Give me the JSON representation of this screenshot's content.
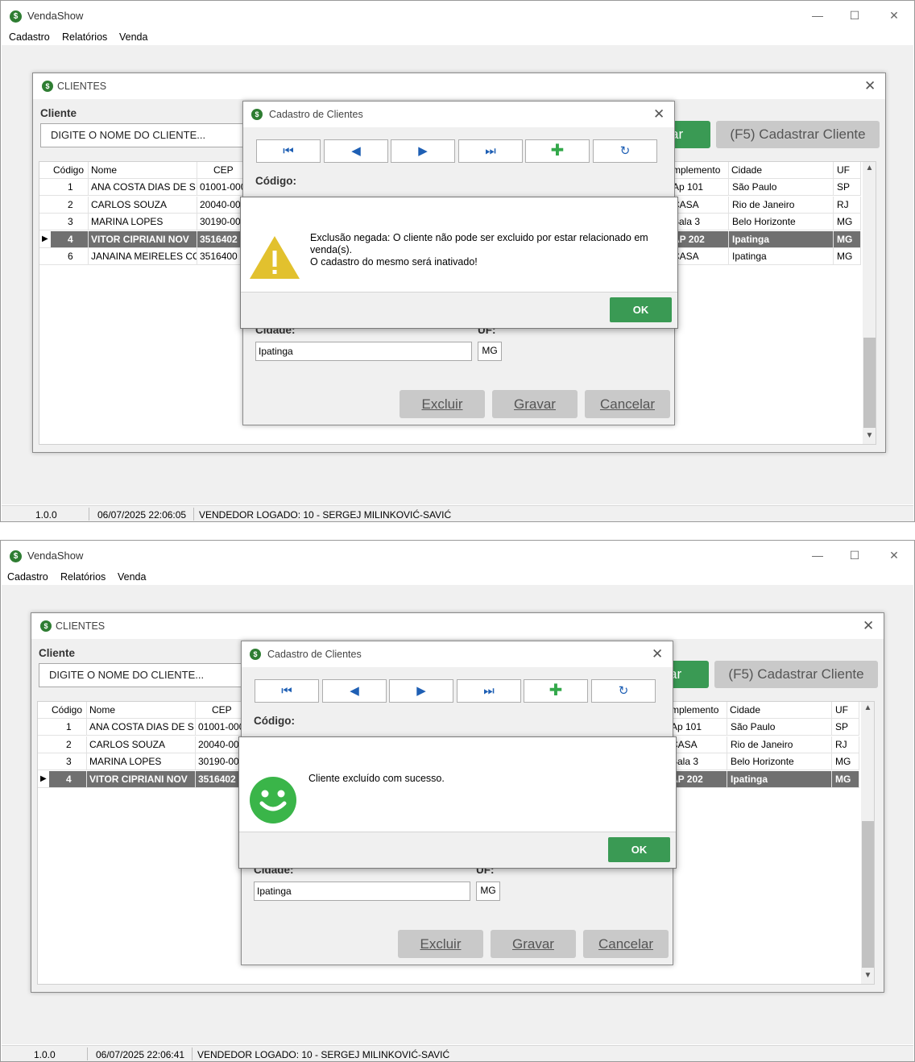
{
  "app": {
    "title": "VendaShow",
    "icon_letter": "$",
    "minimize": "—",
    "maximize": "☐",
    "close": "✕"
  },
  "menu": [
    "Cadastro",
    "Relatórios",
    "Venda"
  ],
  "clientes_window": {
    "title": "CLIENTES",
    "field_label": "Cliente",
    "search_value": "DIGITE O NOME DO CLIENTE...",
    "partial_button": "ar",
    "cadastrar_button": "(F5) Cadastrar Cliente",
    "columns": [
      "Código",
      "Nome",
      "CEP",
      "mplemento",
      "Cidade",
      "UF"
    ]
  },
  "cadastro_window": {
    "title": "Cadastro de Clientes",
    "nav": [
      "⏮",
      "◀",
      "▶",
      "⏭",
      "✚",
      "↻"
    ],
    "codigo_label": "Código:",
    "cidade_label": "Cidade:",
    "uf_label": "UF:",
    "cidade_value": "Ipatinga",
    "uf_value": "MG",
    "excluir": "Excluir",
    "gravar": "Gravar",
    "cancelar": "Cancelar"
  },
  "screens": [
    {
      "status": {
        "version": "1.0.0",
        "datetime": "06/07/2025 22:06:05",
        "vendedor": "VENDEDOR LOGADO:  10 - SERGEJ MILINKOVIĆ-SAVIĆ"
      },
      "rows": [
        {
          "codigo": "1",
          "nome": "ANA COSTA DIAS DE S",
          "cep": "01001-000",
          "complemento": "Ap 101",
          "cidade": "São Paulo",
          "uf": "SP",
          "selected": false
        },
        {
          "codigo": "2",
          "nome": "CARLOS SOUZA",
          "cep": "20040-00",
          "complemento": "CASA",
          "cidade": "Rio de Janeiro",
          "uf": "RJ",
          "selected": false
        },
        {
          "codigo": "3",
          "nome": " MARINA LOPES",
          "cep": "30190-00",
          "complemento": "Sala 3",
          "cidade": "Belo Horizonte",
          "uf": "MG",
          "selected": false
        },
        {
          "codigo": "4",
          "nome": "VITOR CIPRIANI NOV",
          "cep": "3516402",
          "complemento": "AP 202",
          "cidade": "Ipatinga",
          "uf": "MG",
          "selected": true
        },
        {
          "codigo": "6",
          "nome": "JANAINA MEIRELES CC",
          "cep": "3516400",
          "complemento": "CASA",
          "cidade": "Ipatinga",
          "uf": "MG",
          "selected": false
        }
      ],
      "message": {
        "kind": "warning",
        "lines": [
          "Exclusão negada: O cliente não pode ser excluido por estar relacionado em venda(s).",
          "O cadastro do mesmo será inativado!"
        ],
        "ok": "OK"
      }
    },
    {
      "status": {
        "version": "1.0.0",
        "datetime": "06/07/2025 22:06:41",
        "vendedor": "VENDEDOR LOGADO:  10 - SERGEJ MILINKOVIĆ-SAVIĆ"
      },
      "rows": [
        {
          "codigo": "1",
          "nome": "ANA COSTA DIAS DE S",
          "cep": "01001-000",
          "complemento": "Ap 101",
          "cidade": "São Paulo",
          "uf": "SP",
          "selected": false
        },
        {
          "codigo": "2",
          "nome": "CARLOS SOUZA",
          "cep": "20040-00",
          "complemento": "CASA",
          "cidade": "Rio de Janeiro",
          "uf": "RJ",
          "selected": false
        },
        {
          "codigo": "3",
          "nome": " MARINA LOPES",
          "cep": "30190-00",
          "complemento": "Sala 3",
          "cidade": "Belo Horizonte",
          "uf": "MG",
          "selected": false
        },
        {
          "codigo": "4",
          "nome": "VITOR CIPRIANI NOV",
          "cep": "3516402",
          "complemento": "AP 202",
          "cidade": "Ipatinga",
          "uf": "MG",
          "selected": true
        }
      ],
      "message": {
        "kind": "success",
        "lines": [
          "Cliente excluído com sucesso."
        ],
        "ok": "OK"
      }
    }
  ],
  "colors": {
    "accent_green": "#3a9a54",
    "selected_row": "#707070",
    "nav_blue": "#1e5fb4",
    "warning_yellow": "#e2c12e",
    "success_green": "#3ab549"
  }
}
